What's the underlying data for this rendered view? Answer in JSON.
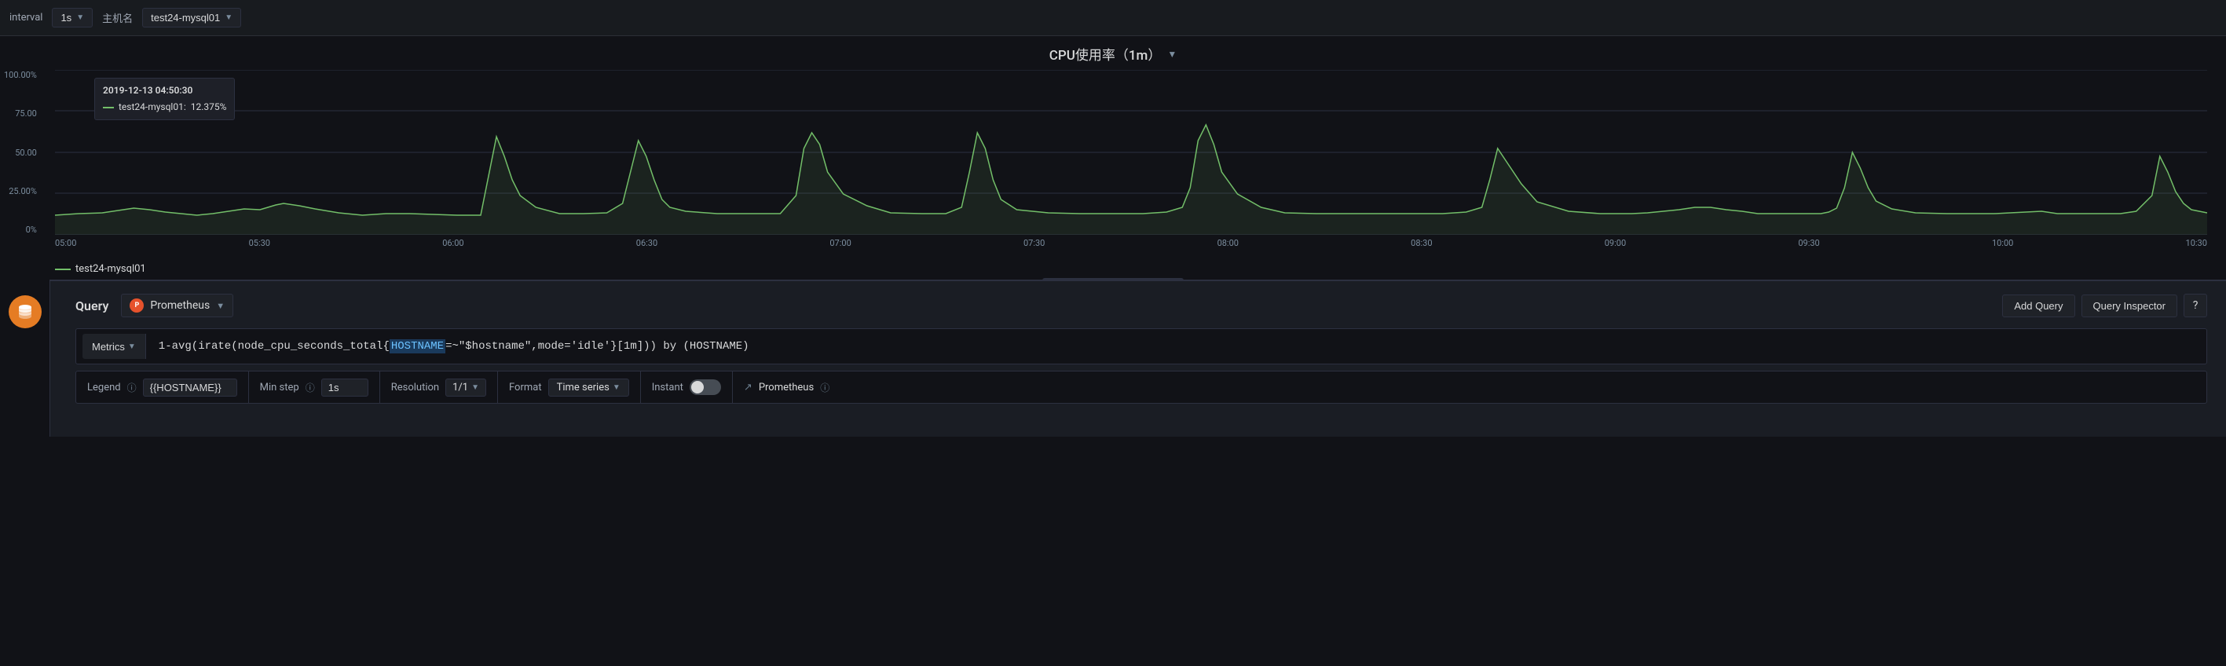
{
  "topbar": {
    "interval_label": "interval",
    "interval_value": "1s",
    "host_label": "主机名",
    "host_value": "test24-mysql01"
  },
  "chart": {
    "title": "CPU使用率（1m）",
    "yaxis": [
      "100.00%",
      "75.00",
      "50.00",
      "25.00%",
      "0%"
    ],
    "xaxis": [
      "05:00",
      "05:30",
      "06:00",
      "06:30",
      "07:00",
      "07:30",
      "08:00",
      "08:30",
      "09:00",
      "09:30",
      "10:00",
      "10:30"
    ],
    "tooltip": {
      "date": "2019-12-13 04:50:30",
      "series": "test24-mysql01:",
      "value": "12.375%"
    },
    "legend": "test24-mysql01"
  },
  "query": {
    "label": "Query",
    "datasource": "Prometheus",
    "add_query_label": "Add Query",
    "query_inspector_label": "Query Inspector",
    "help_label": "?",
    "metrics_label": "Metrics",
    "expression": "1-avg(irate(node_cpu_seconds_total{HOSTNAME=~\"$hostname\",mode='idle'}[1m])) by (HOSTNAME)",
    "expr_parts": {
      "prefix": "1-avg(irate(node_cpu_seconds_total{",
      "highlight": "HOSTNAME",
      "middle": "=~\"$hostname\",mode='idle'}[1m])) by (HOSTNAME)"
    }
  },
  "options": {
    "legend_label": "Legend",
    "legend_value": "{{HOSTNAME}}",
    "min_step_label": "Min step",
    "min_step_info": "ⓘ",
    "min_step_value": "1s",
    "resolution_label": "Resolution",
    "resolution_value": "1/1",
    "format_label": "Format",
    "format_value": "Time series",
    "instant_label": "Instant",
    "prometheus_link": "Prometheus",
    "prometheus_info": "ⓘ"
  }
}
